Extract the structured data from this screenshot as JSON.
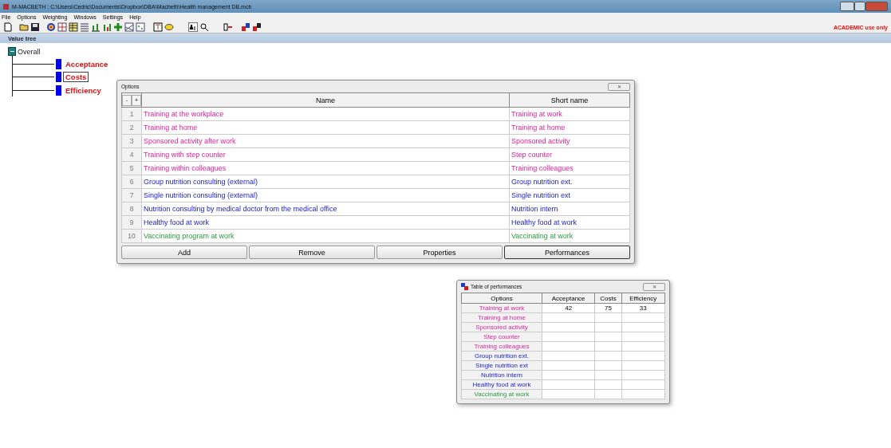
{
  "window": {
    "title": "M-MACBETH : C:\\Users\\Cedric\\Documents\\Dropbox\\DBA\\Macbeth\\Health management DB.mcb",
    "notice": "ACADEMIC use only"
  },
  "menu": [
    "File",
    "Options",
    "Weighting",
    "Windows",
    "Settings",
    "Help"
  ],
  "value_tree": {
    "title": "Value tree",
    "root": {
      "label": "Overall",
      "expanded": true,
      "children": [
        {
          "label": "Acceptance",
          "selected": false
        },
        {
          "label": "Costs",
          "selected": true
        },
        {
          "label": "Efficiency",
          "selected": false
        }
      ]
    }
  },
  "options_window": {
    "title": "Options",
    "close": "✕",
    "collapse": "-",
    "expand": "+",
    "columns": [
      "Name",
      "Short name"
    ],
    "rows": [
      {
        "index": "1",
        "name": "Training at the workplace",
        "short_name": "Training at work",
        "kind": "group-a"
      },
      {
        "index": "2",
        "name": "Training at home",
        "short_name": "Training at home",
        "kind": "group-a"
      },
      {
        "index": "3",
        "name": "Sponsored activity after work",
        "short_name": "Sponsored activity",
        "kind": "group-a"
      },
      {
        "index": "4",
        "name": "Training with step counter",
        "short_name": "Step counter",
        "kind": "group-a"
      },
      {
        "index": "5",
        "name": "Training within colleagues",
        "short_name": "Training colleagues",
        "kind": "group-a"
      },
      {
        "index": "6",
        "name": "Group nutrition consulting (external)",
        "short_name": "Group nutrition ext.",
        "kind": "group-b"
      },
      {
        "index": "7",
        "name": "Single nutrition consulting (external)",
        "short_name": "Single nutrition ext",
        "kind": "group-b"
      },
      {
        "index": "8",
        "name": "Nutrition consulting by medical doctor from the medical office",
        "short_name": "Nutrition intern",
        "kind": "group-b"
      },
      {
        "index": "9",
        "name": "Healthy food at work",
        "short_name": "Healthy food at work",
        "kind": "group-b"
      },
      {
        "index": "10",
        "name": "Vaccinating program at work",
        "short_name": "Vaccinating at work",
        "kind": "group-c"
      }
    ],
    "buttons": [
      {
        "label": "Add",
        "default": false
      },
      {
        "label": "Remove",
        "default": false
      },
      {
        "label": "Properties",
        "default": false
      },
      {
        "label": "Performances",
        "default": true
      }
    ]
  },
  "performances_window": {
    "title": "Table of performances",
    "close": "✕",
    "columns": [
      "Options",
      "Acceptance",
      "Costs",
      "Efficiency"
    ],
    "rows": [
      {
        "option": "Training at work",
        "values": [
          "42",
          "75",
          "33"
        ],
        "kind": "group-a"
      },
      {
        "option": "Training at home",
        "kind": "group-a"
      },
      {
        "option": "Sponsored activity",
        "kind": "group-a"
      },
      {
        "option": "Step counter",
        "kind": "group-a"
      },
      {
        "option": "Training colleagues",
        "kind": "group-a"
      },
      {
        "option": "Group nutrition ext.",
        "kind": "group-b"
      },
      {
        "option": "Single nutrition ext",
        "kind": "group-b"
      },
      {
        "option": "Nutrition intern",
        "kind": "group-b"
      },
      {
        "option": "Healthy food at work",
        "kind": "group-b"
      },
      {
        "option": "Vaccinating at work",
        "kind": "group-c"
      }
    ]
  }
}
